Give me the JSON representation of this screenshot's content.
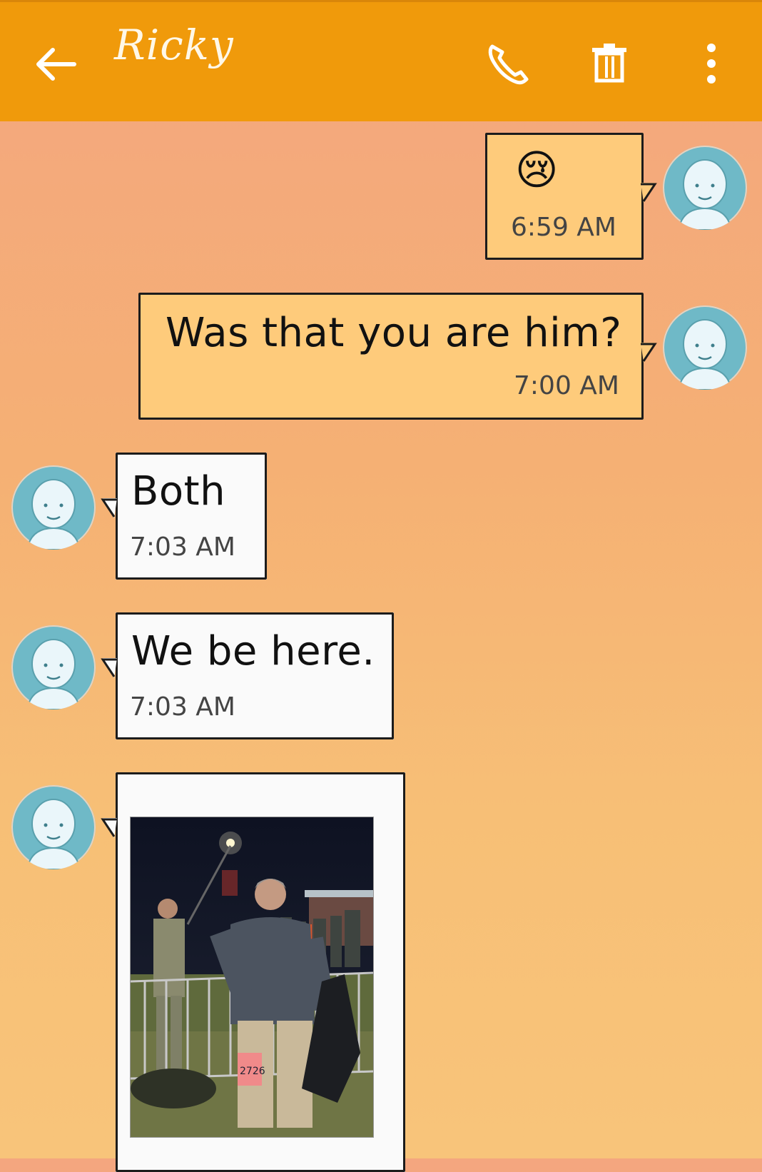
{
  "header": {
    "contact_name": "Ricky",
    "icons": [
      "back-arrow-icon",
      "phone-icon",
      "trash-icon",
      "more-vert-icon"
    ]
  },
  "messages": [
    {
      "direction": "outgoing",
      "text": "😢",
      "time": "6:59 AM"
    },
    {
      "direction": "outgoing",
      "text": "Was that you are him?",
      "time": "7:00 AM"
    },
    {
      "direction": "incoming",
      "text": "Both",
      "time": "7:03 AM"
    },
    {
      "direction": "incoming",
      "text": "We be here.",
      "time": "7:03 AM"
    },
    {
      "direction": "incoming",
      "type": "image",
      "image_desc": "photo"
    }
  ],
  "colors": {
    "header": "#f09a0b",
    "outgoing_bubble": "#fecb7b",
    "incoming_bubble": "#fafafa",
    "avatar": "#6fb9c7"
  }
}
